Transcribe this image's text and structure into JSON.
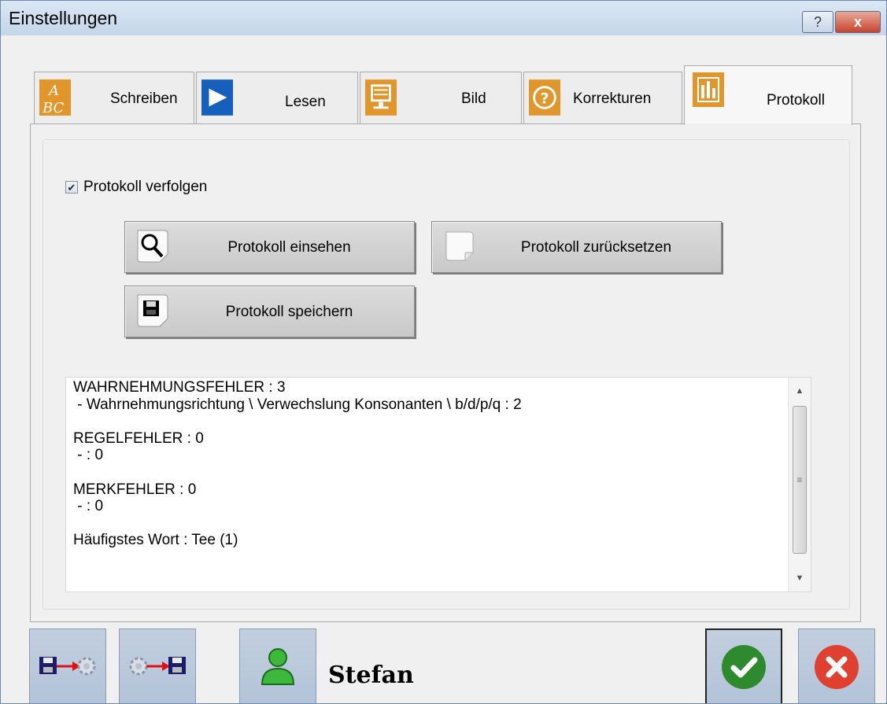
{
  "window": {
    "title": "Einstellungen",
    "help_label": "?",
    "close_label": "x"
  },
  "tabs": [
    {
      "label": "Schreiben",
      "icon": "abc-icon"
    },
    {
      "label": "Lesen",
      "icon": "play-icon"
    },
    {
      "label": "Bild",
      "icon": "monitor-icon"
    },
    {
      "label": "Korrekturen",
      "icon": "question-icon"
    },
    {
      "label": "Protokoll",
      "icon": "chart-icon",
      "active": true
    }
  ],
  "protocol": {
    "track_label": "Protokoll verfolgen",
    "track_checked": true,
    "view_label": "Protokoll einsehen",
    "reset_label": "Protokoll zurücksetzen",
    "save_label": "Protokoll speichern",
    "log_text": "WAHRNEHMUNGSFEHLER : 3\n - Wahrnehmungsrichtung \\ Verwechslung Konsonanten \\ b/d/p/q : 2\n\nREGELFEHLER : 0\n - : 0\n\nMERKFEHLER : 0\n - : 0\n\nHäufigstes Wort : Tee (1)"
  },
  "footer": {
    "user_name": "Stefan",
    "colors": {
      "ok": "#2d8a2d",
      "cancel": "#e04030",
      "button_bg": "#bac9dc"
    }
  }
}
